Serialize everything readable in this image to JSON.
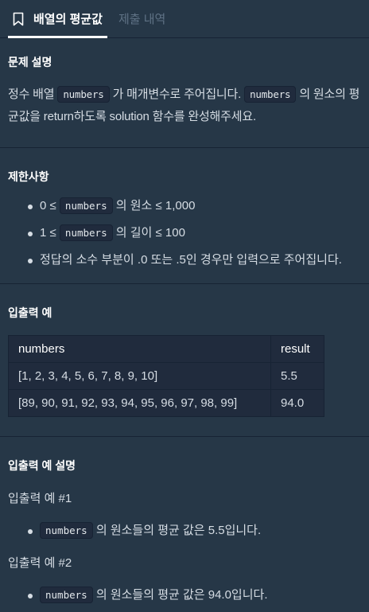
{
  "tabs": {
    "active_label": "배열의 평균값",
    "inactive_label": "제출 내역",
    "bookmark_icon": "bookmark-icon"
  },
  "problem": {
    "title": "문제 설명",
    "desc_part1": "정수 배열 ",
    "desc_code1": "numbers",
    "desc_part2": " 가 매개변수로 주어집니다. ",
    "desc_code2": "numbers",
    "desc_part3": " 의 원소의 평균값을 return하도록 solution 함수를 완성해주세요."
  },
  "constraints": {
    "title": "제한사항",
    "items": [
      {
        "pre": "0 ≤ ",
        "code": "numbers",
        "post": " 의 원소 ≤ 1,000"
      },
      {
        "pre": "1 ≤ ",
        "code": "numbers",
        "post": " 의 길이 ≤ 100"
      },
      {
        "pre": "정답의 소수 부분이 .0 또는 .5인 경우만 입력으로 주어집니다.",
        "code": "",
        "post": ""
      }
    ]
  },
  "io_examples": {
    "title": "입출력 예",
    "headers": [
      "numbers",
      "result"
    ],
    "rows": [
      [
        "[1, 2, 3, 4, 5, 6, 7, 8, 9, 10]",
        "5.5"
      ],
      [
        "[89, 90, 91, 92, 93, 94, 95, 96, 97, 98, 99]",
        "94.0"
      ]
    ]
  },
  "io_explanation": {
    "title": "입출력 예 설명",
    "examples": [
      {
        "label": "입출력 예 #1",
        "code": "numbers",
        "text": " 의 원소들의 평균 값은 5.5입니다."
      },
      {
        "label": "입출력 예 #2",
        "code": "numbers",
        "text": " 의 원소들의 평균 값은 94.0입니다."
      }
    ]
  }
}
